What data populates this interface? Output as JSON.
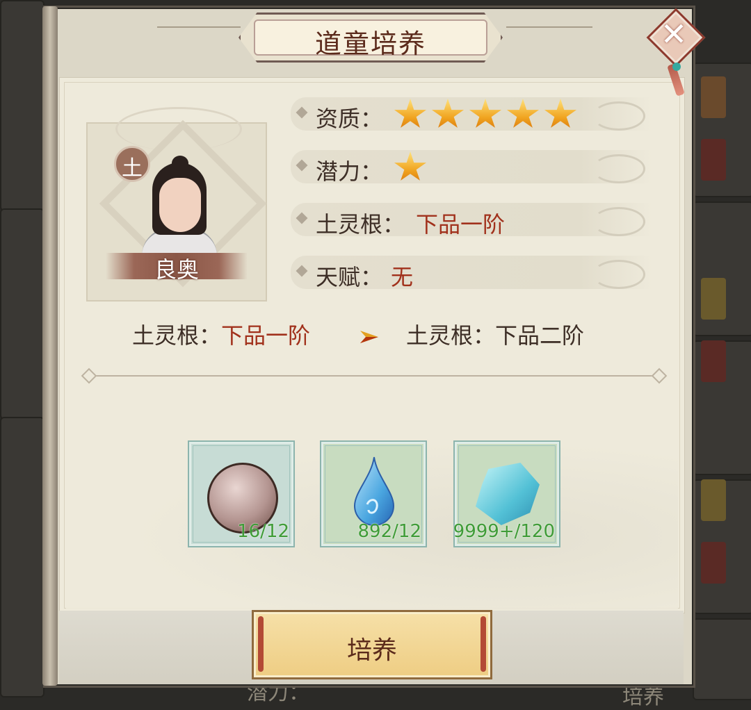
{
  "dialog": {
    "title": "道童培养",
    "close_icon": "close-x-icon"
  },
  "character": {
    "name": "良奥",
    "element_badge": "土"
  },
  "info_rows": [
    {
      "label": "资质：",
      "stars": 5
    },
    {
      "label": "潜力：",
      "stars": 1
    },
    {
      "label": "土灵根：",
      "value": "下品一阶"
    },
    {
      "label": "天赋：",
      "value": "无"
    }
  ],
  "upgrade": {
    "from_label": "土灵根：",
    "from_value": "下品一阶",
    "to_label": "土灵根：",
    "to_value": "下品二阶"
  },
  "materials": [
    {
      "icon": "pearl-icon",
      "count": "16/12"
    },
    {
      "icon": "water-drop-icon",
      "count": "892/12"
    },
    {
      "icon": "crystal-icon",
      "count": "9999+/120"
    }
  ],
  "cultivate_button": "培养",
  "background": {
    "peek_left": "潜力：",
    "peek_right": "培养"
  },
  "colors": {
    "title_text": "#5b2a1b",
    "value_red": "#a1311c",
    "count_green": "#3f9c38",
    "button_gold": "#eecd83"
  }
}
